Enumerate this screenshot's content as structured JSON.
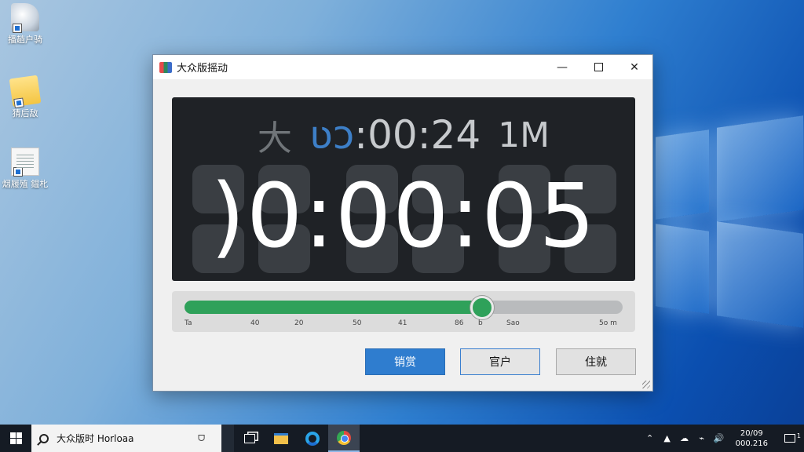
{
  "desktop": {
    "icons": [
      {
        "label": "播趟户骑",
        "icon": "disk-icon"
      },
      {
        "label": "猜后敌",
        "icon": "folder-icon"
      },
      {
        "label": "烟履殖 鎾朼",
        "icon": "document-icon"
      }
    ]
  },
  "window": {
    "title": "大众版摇动",
    "controls": {
      "minimize": "—",
      "maximize": "□",
      "close": "✕"
    }
  },
  "display": {
    "top_left": "大",
    "top_prefix": "ʋɔ",
    "top_time": ":00:24",
    "top_right": "1M",
    "main_time": ")0:00:05"
  },
  "slider": {
    "progress_percent": 68,
    "tick_labels": [
      "Ta",
      "40",
      "20",
      "50",
      "41",
      "86",
      "b",
      "Sao",
      "5o m"
    ],
    "colors": {
      "fill": "#2fa15a",
      "track": "#b9bbbd"
    }
  },
  "buttons": {
    "primary": "销赏",
    "secondary": "官户",
    "tertiary": "住就"
  },
  "taskbar": {
    "search_text": "大众版时 Horloaa",
    "mic_label": "ᗜ",
    "tray": {
      "chevron": "⌃",
      "icon1": "▲",
      "icon2": "☁",
      "icon3": "⌁",
      "icon4": "🔊"
    },
    "clock_line1": "20/09",
    "clock_line2": "000.216",
    "notification_count": "1"
  }
}
